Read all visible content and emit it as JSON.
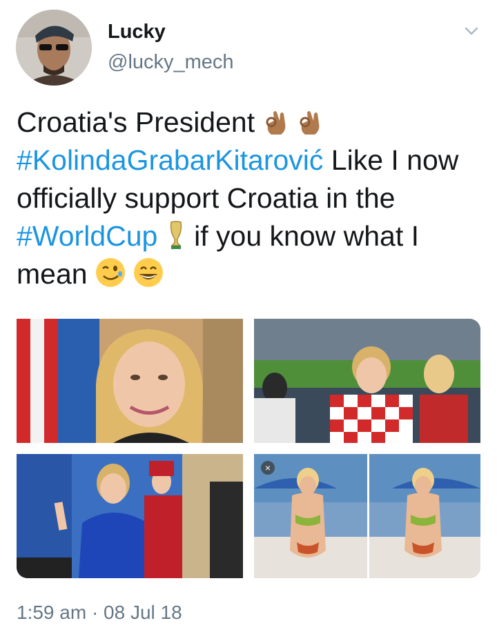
{
  "user": {
    "name": "Lucky",
    "handle": "@lucky_mech"
  },
  "tweet": {
    "t1": "Croatia's President ",
    "h1": "#KolindaGrabarKitarović",
    "t2": " Like I now officially support Croatia in the ",
    "h2": "#WorldCup",
    "t3": " if you know what I mean "
  },
  "icons": [
    "chevron-down",
    "ok-hand",
    "trophy",
    "wink-face",
    "grin-face",
    "close"
  ],
  "photos": [
    {
      "name": "portrait with flag"
    },
    {
      "name": "stadium crowd"
    },
    {
      "name": "inauguration"
    },
    {
      "name": "beach bikini"
    }
  ],
  "close_glyph": "×",
  "meta": {
    "timestamp": "1:59 am · 08 Jul 18"
  },
  "colors": {
    "link": "#1b95e0",
    "muted": "#657786",
    "text": "#14171a"
  }
}
